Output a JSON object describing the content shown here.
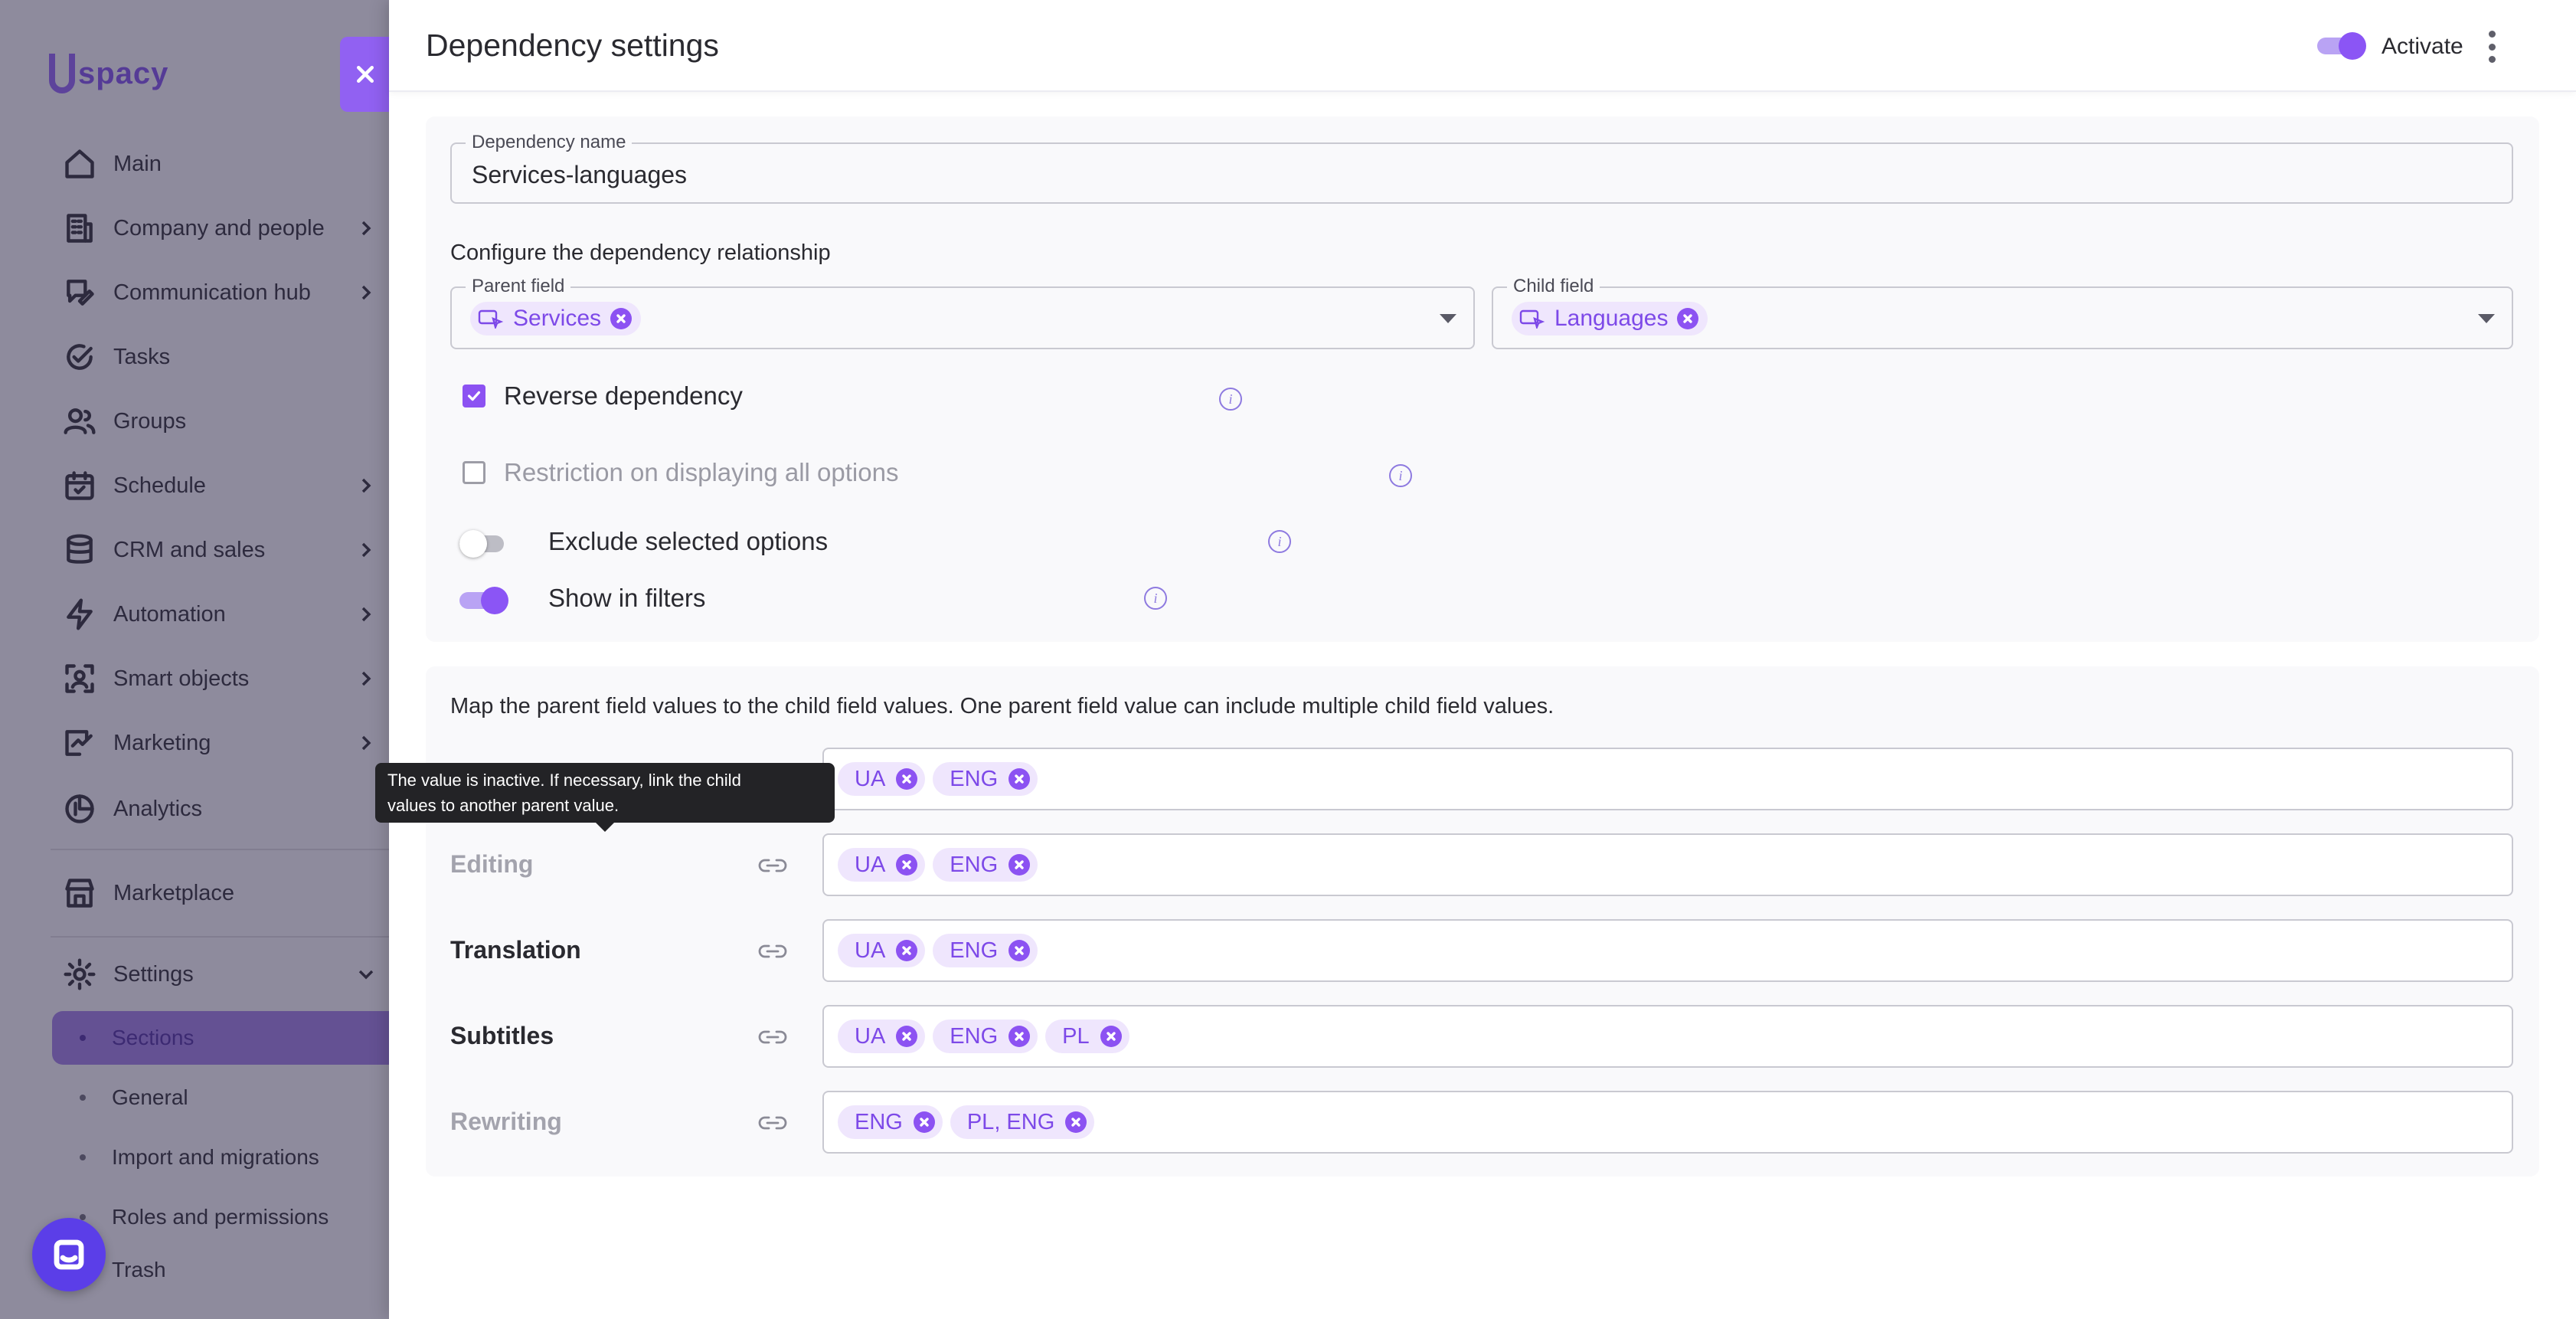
{
  "app": {
    "logo_text": "spacy"
  },
  "sidebar": {
    "items": [
      {
        "label": "Main",
        "icon": "home-icon",
        "has_chevron": false
      },
      {
        "label": "Company and people",
        "icon": "building-icon",
        "has_chevron": true
      },
      {
        "label": "Communication hub",
        "icon": "chat-edit-icon",
        "has_chevron": true
      },
      {
        "label": "Tasks",
        "icon": "check-circle-icon",
        "has_chevron": false
      },
      {
        "label": "Groups",
        "icon": "users-icon",
        "has_chevron": false
      },
      {
        "label": "Schedule",
        "icon": "calendar-icon",
        "has_chevron": true
      },
      {
        "label": "CRM and sales",
        "icon": "database-icon",
        "has_chevron": true
      },
      {
        "label": "Automation",
        "icon": "lightning-icon",
        "has_chevron": true
      },
      {
        "label": "Smart objects",
        "icon": "scan-user-icon",
        "has_chevron": true
      },
      {
        "label": "Marketing",
        "icon": "megaphone-icon",
        "has_chevron": true
      },
      {
        "label": "Analytics",
        "icon": "pie-chart-icon",
        "has_chevron": false
      },
      {
        "label": "Marketplace",
        "icon": "store-icon",
        "has_chevron": false
      },
      {
        "label": "Settings",
        "icon": "gear-icon",
        "has_chevron": true,
        "expanded": true
      }
    ],
    "settings_sub": [
      {
        "label": "Sections",
        "active": true
      },
      {
        "label": "General",
        "active": false
      },
      {
        "label": "Import and migrations",
        "active": false
      },
      {
        "label": "Roles and permissions",
        "active": false
      },
      {
        "label": "Trash",
        "active": false
      }
    ]
  },
  "panel": {
    "title": "Dependency settings",
    "activate_label": "Activate",
    "activate_on": true
  },
  "form": {
    "dependency_name": {
      "label": "Dependency name",
      "value": "Services-languages"
    },
    "configure_label": "Configure the dependency relationship",
    "parent_field": {
      "label": "Parent field",
      "value": "Services"
    },
    "child_field": {
      "label": "Child field",
      "value": "Languages"
    },
    "reverse_dependency": {
      "label": "Reverse dependency",
      "checked": true
    },
    "restriction": {
      "label": "Restriction on displaying all options",
      "checked": false,
      "disabled": true
    },
    "exclude_selected": {
      "label": "Exclude selected options",
      "on": false
    },
    "show_in_filters": {
      "label": "Show in filters",
      "on": true
    }
  },
  "mapping": {
    "description": "Map the parent field values to the child field values. One parent field value can include multiple child field values.",
    "rows": [
      {
        "label": "",
        "active": false,
        "values": [
          "UA",
          "ENG"
        ]
      },
      {
        "label": "Editing",
        "active": false,
        "values": [
          "UA",
          "ENG"
        ]
      },
      {
        "label": "Translation",
        "active": true,
        "values": [
          "UA",
          "ENG"
        ]
      },
      {
        "label": "Subtitles",
        "active": true,
        "values": [
          "UA",
          "ENG",
          "PL"
        ]
      },
      {
        "label": "Rewriting",
        "active": false,
        "values": [
          "ENG",
          "PL, ENG"
        ]
      }
    ]
  },
  "tooltip": {
    "line1": "The value is inactive. If necessary, link the child",
    "line2": "values to another parent value."
  },
  "colors": {
    "accent": "#8C52F2",
    "chip_bg": "#EFE6FD",
    "chip_text": "#7D49E8"
  }
}
